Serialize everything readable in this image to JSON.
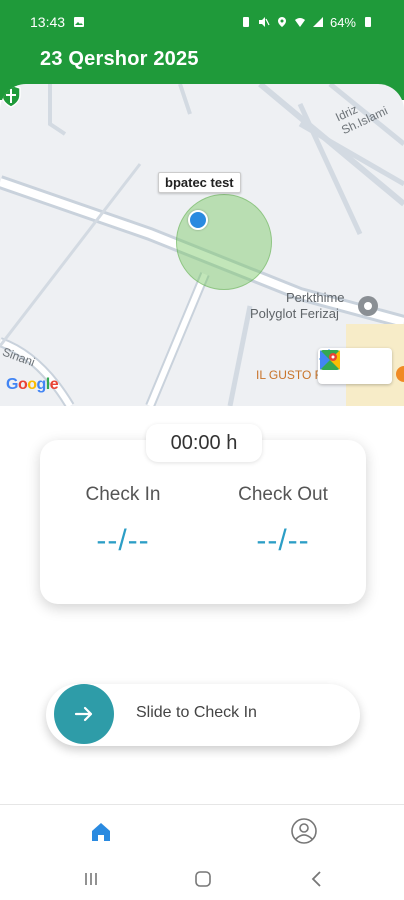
{
  "status_bar": {
    "time": "13:43",
    "battery": "64%"
  },
  "header": {
    "date_title": "23 Qershor 2025"
  },
  "map": {
    "location_name": "bpatec test",
    "street_label": "Idriz Sh.Islami",
    "poi_name_line1": "Perkthime",
    "poi_name_line2": "Polyglot Ferizaj",
    "restaurant_label": "IL GUSTO Ristorante",
    "street_label_left": "Sinani",
    "attribution": "Google"
  },
  "card": {
    "timer": "00:00 h",
    "check_in_label": "Check In",
    "check_in_value": "--/--",
    "check_out_label": "Check Out",
    "check_out_value": "--/--"
  },
  "slider": {
    "label": "Slide to Check In"
  },
  "colors": {
    "header_green": "#1f9a3a",
    "accent_teal": "#2e9ca8",
    "value_blue": "#2c9ec6",
    "nav_active": "#2a8ae0"
  }
}
